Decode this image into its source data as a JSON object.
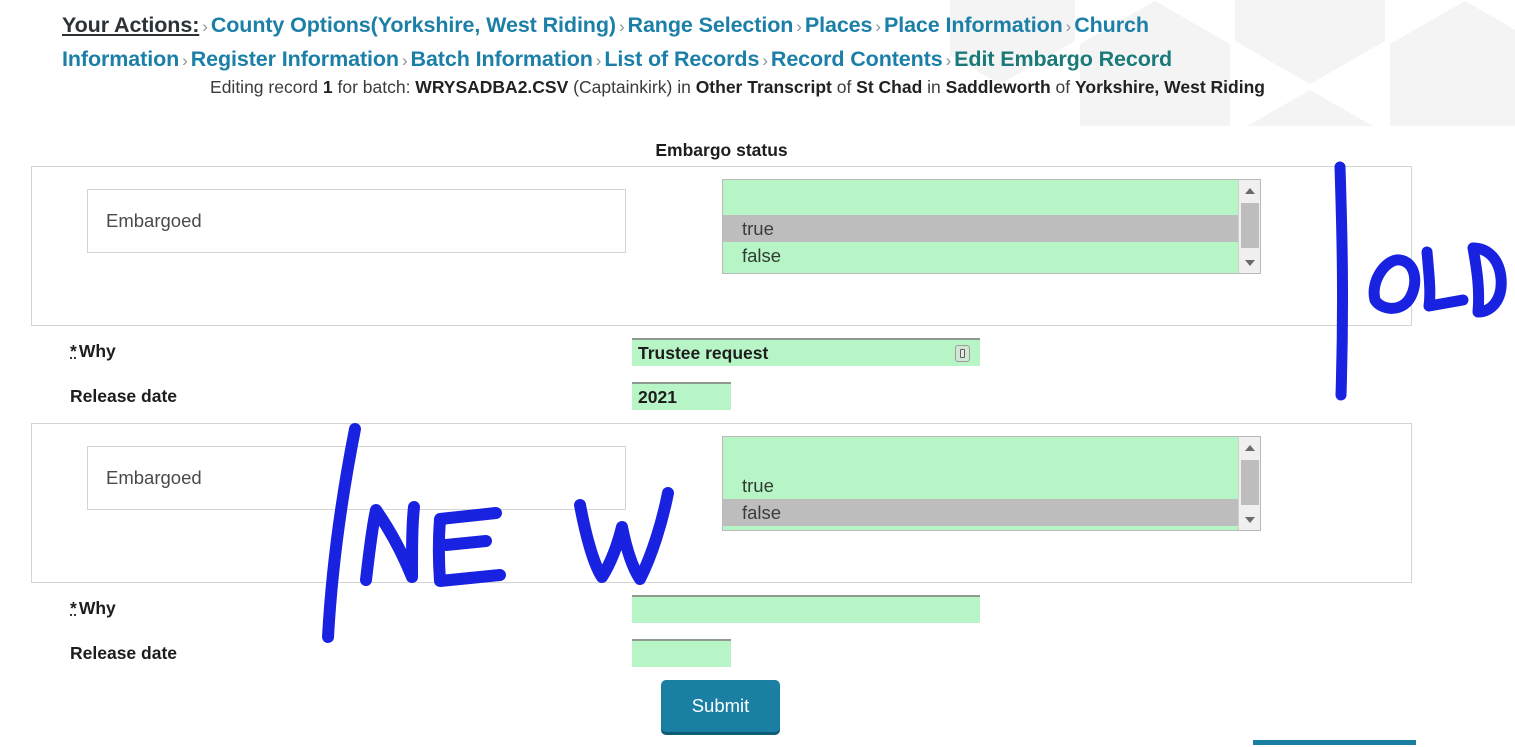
{
  "breadcrumb": {
    "root_label": "Your Actions:",
    "separator": "›",
    "items": [
      {
        "label": "County Options(Yorkshire, West Riding)",
        "current": false
      },
      {
        "label": "Range Selection",
        "current": false
      },
      {
        "label": "Places",
        "current": false
      },
      {
        "label": "Place Information",
        "current": false
      },
      {
        "label": "Church Information",
        "current": false
      },
      {
        "label": "Register Information",
        "current": false
      },
      {
        "label": "Batch Information",
        "current": false
      },
      {
        "label": "List of Records",
        "current": false
      },
      {
        "label": "Record Contents",
        "current": false
      },
      {
        "label": "Edit Embargo Record",
        "current": true
      }
    ]
  },
  "subtitle": {
    "prefix": "Editing record ",
    "record_number": "1",
    "for_batch": " for batch: ",
    "batch_file": "WRYSADBA2.CSV",
    "user": " (Captainkirk) in ",
    "transcript": "Other Transcript",
    "of1": " of ",
    "church": "St Chad",
    "in1": " in ",
    "place": "Saddleworth",
    "of2": " of ",
    "county": "Yorkshire, West Riding"
  },
  "section": {
    "heading": "Embargo status"
  },
  "groups": [
    {
      "id": "old",
      "embargoed_label": "Embargoed",
      "options": [
        {
          "label": "true",
          "selected": true
        },
        {
          "label": "false",
          "selected": false
        }
      ],
      "fields": {
        "why_label": "Why",
        "why_required_marker": "*",
        "why_value": "Trustee request",
        "why_placeholder": "",
        "release_label": "Release date",
        "release_value": "2021",
        "release_placeholder": ""
      },
      "autofill_icon": "autofill-icon"
    },
    {
      "id": "new",
      "embargoed_label": "Embargoed",
      "options": [
        {
          "label": "true",
          "selected": false
        },
        {
          "label": "false",
          "selected": true
        }
      ],
      "fields": {
        "why_label": "Why",
        "why_required_marker": "*",
        "why_value": "",
        "why_placeholder": "",
        "release_label": "Release date",
        "release_value": "",
        "release_placeholder": ""
      },
      "autofill_icon": ""
    }
  ],
  "submit": {
    "label": "Submit"
  },
  "annotations": [
    {
      "text": "OLD",
      "color": "#1822E0"
    },
    {
      "text": "NEW",
      "color": "#1822E0"
    }
  ],
  "colors": {
    "link": "#1b7fa8",
    "current_crumb": "#197a79",
    "field_green": "#b8f5c6",
    "selected_gray": "#bdbdbd",
    "submit_teal": "#1b7fa3",
    "annotation_blue": "#1822E0"
  },
  "icons": {
    "scroll_up": "triangle-up-icon",
    "scroll_down": "triangle-down-icon"
  }
}
